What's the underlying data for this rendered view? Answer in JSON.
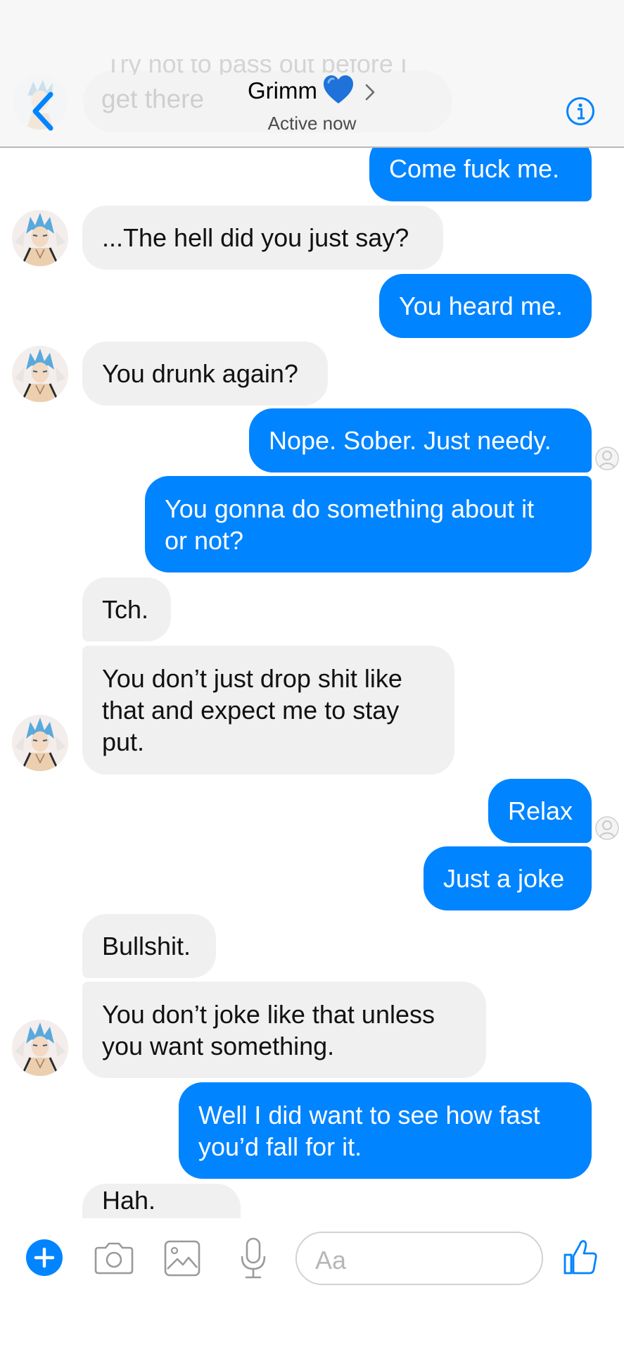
{
  "header": {
    "prev_message_partial": "Try not to pass out before I",
    "prev_message_line2": "get there",
    "contact_name": "Grimm",
    "name_emoji_icon": "blue-heart-icon",
    "status": "Active now",
    "back_icon": "chevron-left-icon",
    "info_icon": "info-icon"
  },
  "messages": [
    {
      "sender": "me",
      "text": "Come fuck me."
    },
    {
      "sender": "Grimm",
      "text": "...The hell did you just say?"
    },
    {
      "sender": "me",
      "text": "You heard me."
    },
    {
      "sender": "Grimm",
      "text": "You drunk again?"
    },
    {
      "sender": "me",
      "text": "Nope. Sober. Just needy."
    },
    {
      "sender": "me",
      "text": "You gonna do something about it\nor not?"
    },
    {
      "sender": "Grimm",
      "text": "Tch."
    },
    {
      "sender": "Grimm",
      "text": "You don’t just drop shit like\nthat and expect me to stay\nput."
    },
    {
      "sender": "me",
      "text": "Relax"
    },
    {
      "sender": "me",
      "text": "Just a joke"
    },
    {
      "sender": "Grimm",
      "text": "Bullshit."
    },
    {
      "sender": "Grimm",
      "text": "You don’t joke like that unless\nyou want something."
    },
    {
      "sender": "me",
      "text": "Well I did want to see how fast\nyou’d fall for it."
    },
    {
      "sender": "Grimm",
      "text": "Hah. Cute."
    }
  ],
  "composer": {
    "placeholder": "Aa",
    "icons": [
      "plus-icon",
      "camera-icon",
      "image-icon",
      "microphone-icon",
      "thumbs-up-icon"
    ]
  },
  "colors": {
    "outgoing_bubble": "#0084ff",
    "incoming_bubble": "#f0f0f0",
    "accent": "#0084ff"
  }
}
